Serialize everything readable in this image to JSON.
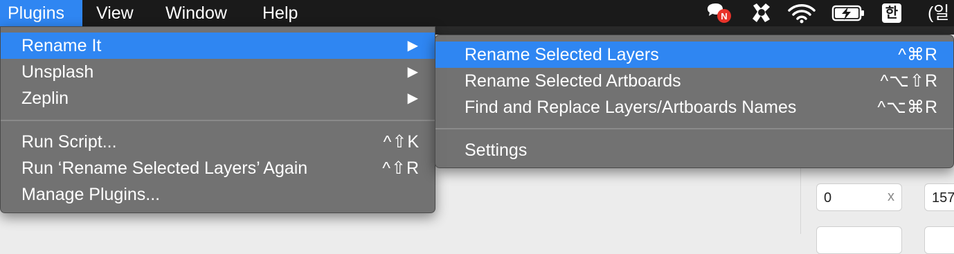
{
  "menubar": {
    "items": [
      {
        "label": "Plugins"
      },
      {
        "label": "View"
      },
      {
        "label": "Window"
      },
      {
        "label": "Help"
      }
    ],
    "status": {
      "notification_badge": "N",
      "input_method": "한",
      "clock_partial": "(일"
    }
  },
  "plugins_menu": {
    "items": [
      {
        "label": "Rename It",
        "has_submenu": true
      },
      {
        "label": "Unsplash",
        "has_submenu": true
      },
      {
        "label": "Zeplin",
        "has_submenu": true
      },
      {
        "label": "Run Script...",
        "shortcut": "^⇧K"
      },
      {
        "label": "Run ‘Rename Selected Layers’ Again",
        "shortcut": "^⇧R"
      },
      {
        "label": "Manage Plugins..."
      }
    ],
    "submenu_arrow": "▶"
  },
  "rename_submenu": {
    "items": [
      {
        "label": "Rename Selected Layers",
        "shortcut": "^⌘R"
      },
      {
        "label": "Rename Selected Artboards",
        "shortcut": "^⌥⇧R"
      },
      {
        "label": "Find and Replace Layers/Artboards Names",
        "shortcut": "^⌥⌘R"
      },
      {
        "label": "Settings"
      }
    ]
  },
  "inspector": {
    "x_value": "0",
    "x_label": "x",
    "y_value_partial": "157"
  },
  "colors": {
    "menubar_bg": "#1a1a1a",
    "highlight": "#2f86f2",
    "menu_bg": "#6c6c6c",
    "badge_red": "#e8332a"
  }
}
